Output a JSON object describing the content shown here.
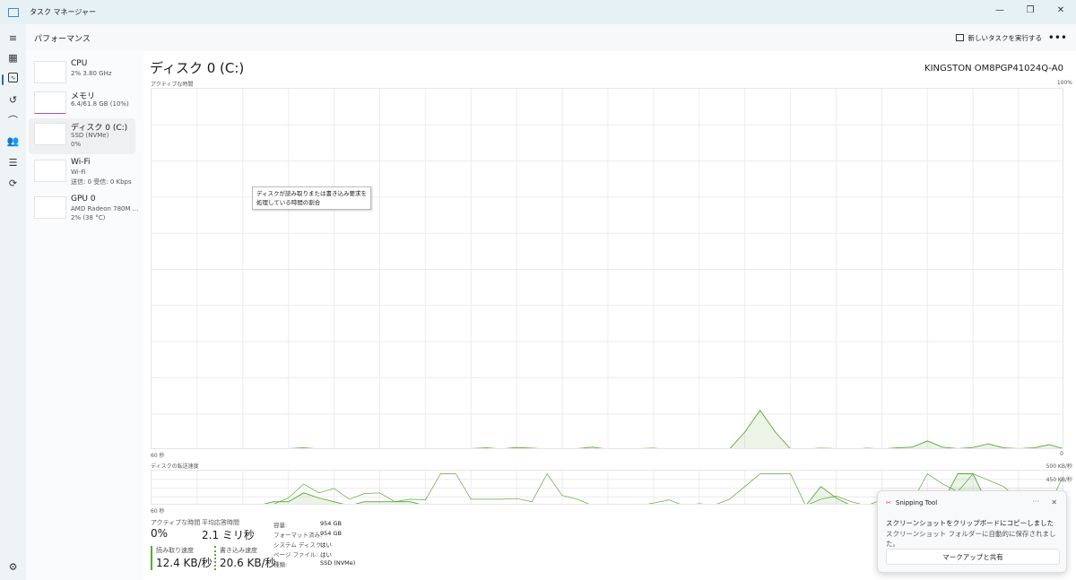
{
  "window": {
    "title": "タスク マネージャー",
    "minimize": "—",
    "maximize": "❐",
    "close": "✕"
  },
  "header": {
    "title": "パフォーマンス",
    "new_task": "新しいタスクを実行する",
    "more": "•••"
  },
  "sidebar": [
    {
      "name": "CPU",
      "line1": "2% 3.80 GHz",
      "line2": "",
      "color": "#3a8fd0"
    },
    {
      "name": "メモリ",
      "line1": "6.4/61.8 GB (10%)",
      "line2": "",
      "color": "#b04fb0"
    },
    {
      "name": "ディスク 0 (C:)",
      "line1": "SSD (NVMe)",
      "line2": "0%",
      "color": "#5aa83a"
    },
    {
      "name": "Wi-Fi",
      "line1": "Wi-Fi",
      "line2": "送信: 0 受信: 0 Kbps",
      "color": "#c0672a"
    },
    {
      "name": "GPU 0",
      "line1": "AMD Radeon 780M ...",
      "line2": "2% (38 °C)",
      "color": "#3a8fd0"
    }
  ],
  "main": {
    "title": "ディスク 0 (C:)",
    "model": "KINGSTON OM8PGP41024Q-A0",
    "active_label": "アクティブな時間",
    "max_label": "100%",
    "left_time": "60 秒",
    "right_zero": "0",
    "tooltip_line1": "ディスクが読み取りまたは書き込み要求を",
    "tooltip_line2": "処理している時間の割合",
    "transfer_label": "ディスクの転送速度",
    "transfer_max": "500 KB/秒",
    "transfer_mid": "450 KB/秒",
    "transfer_time": "60 秒"
  },
  "stats": {
    "active_label": "アクティブな時間",
    "active": "0%",
    "resp_label": "平均応答時間",
    "resp": "2.1 ミリ秒",
    "read_label": "読み取り速度",
    "read": "12.4 KB/秒",
    "write_label": "書き込み速度",
    "write": "20.6 KB/秒",
    "props": [
      [
        "容量:",
        "954 GB"
      ],
      [
        "フォーマット済み:",
        "954 GB"
      ],
      [
        "システム ディスク:",
        "はい"
      ],
      [
        "ページ ファイル:",
        "はい"
      ],
      [
        "種類:",
        "SSD (NVMe)"
      ]
    ]
  },
  "toast": {
    "app": "Snipping Tool",
    "dots": "···",
    "close": "✕",
    "msg1": "スクリーンショットをクリップボードにコピーしました",
    "msg2": "スクリーンショット フォルダーに自動的に保存されました。",
    "button": "マークアップと共有"
  },
  "chart_data": {
    "type": "line",
    "accent": "#5aa83a",
    "active_time_pct": [
      0,
      0,
      0,
      0,
      0,
      0,
      0,
      0,
      0.3,
      0.4,
      0.6,
      0.3,
      0.2,
      0.4,
      0.3,
      0.2,
      0.3,
      0.4,
      0.4,
      0.4,
      0.4,
      0.4,
      0.6,
      0.3,
      0.7,
      0.5,
      0.3,
      0.3,
      0.4,
      0.8,
      0.2,
      0.4,
      0.4,
      0.5,
      0.2,
      0.3,
      0.3,
      0.4,
      0.3,
      5,
      11,
      5,
      0.3,
      0.3,
      0.5,
      0.4,
      0.2,
      0.5,
      0.3,
      0.6,
      0.8,
      2.5,
      0.8,
      0.4,
      0.7,
      1.7,
      0.6,
      0.4,
      0.6,
      1.5,
      0.3
    ],
    "read_kbps": [
      0,
      0,
      0,
      0,
      0,
      0,
      0,
      0,
      60,
      60,
      200,
      120,
      60,
      0,
      60,
      60,
      60,
      60,
      0,
      0,
      0,
      0,
      0,
      0,
      0,
      0,
      0,
      0,
      0,
      0,
      0,
      0,
      0,
      0,
      0,
      0,
      0,
      0,
      0,
      0,
      0,
      0,
      0,
      0,
      300,
      120,
      0,
      0,
      0,
      0,
      0,
      60,
      60,
      500,
      500,
      0,
      0,
      0,
      0,
      0,
      0
    ],
    "write_kbps": [
      0,
      0,
      0,
      0,
      0,
      0,
      0,
      0,
      20,
      120,
      340,
      200,
      270,
      100,
      190,
      200,
      60,
      100,
      90,
      500,
      500,
      100,
      100,
      100,
      110,
      60,
      500,
      160,
      100,
      0,
      0,
      0,
      0,
      40,
      90,
      0,
      30,
      10,
      100,
      300,
      500,
      500,
      500,
      0,
      100,
      150,
      60,
      0,
      90,
      60,
      60,
      500,
      340,
      220,
      500,
      400,
      300,
      100,
      0,
      0,
      500
    ]
  }
}
